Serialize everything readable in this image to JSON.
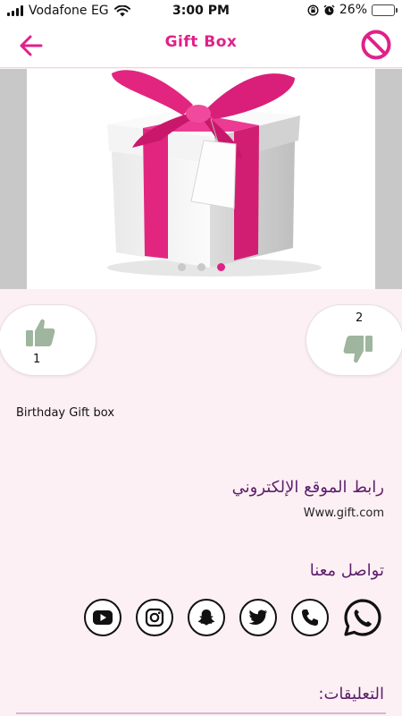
{
  "status_bar": {
    "carrier": "Vodafone EG",
    "time": "3:00 PM",
    "battery_percent": "26%",
    "battery_level": 0.26,
    "battery_color": "#f2c200"
  },
  "nav": {
    "title": "Gift Box",
    "back_icon": "arrow-left-icon",
    "block_icon": "block-icon",
    "accent_color": "#e0218a"
  },
  "gallery": {
    "image": "gift-box-pink-ribbon",
    "slide_count": 3,
    "active_index": 2
  },
  "votes": {
    "likes": "1",
    "dislikes": "2",
    "icon_color": "#9fb59e"
  },
  "description": "Birthday Gift box",
  "website": {
    "heading": "رابط الموقع الإلكتروني",
    "url": "Www.gift.com"
  },
  "contact": {
    "heading": "تواصل معنا",
    "channels": [
      "whatsapp-icon",
      "phone-icon",
      "twitter-icon",
      "snapchat-icon",
      "instagram-icon",
      "youtube-icon"
    ]
  },
  "comments": {
    "heading": "التعليقات:"
  }
}
